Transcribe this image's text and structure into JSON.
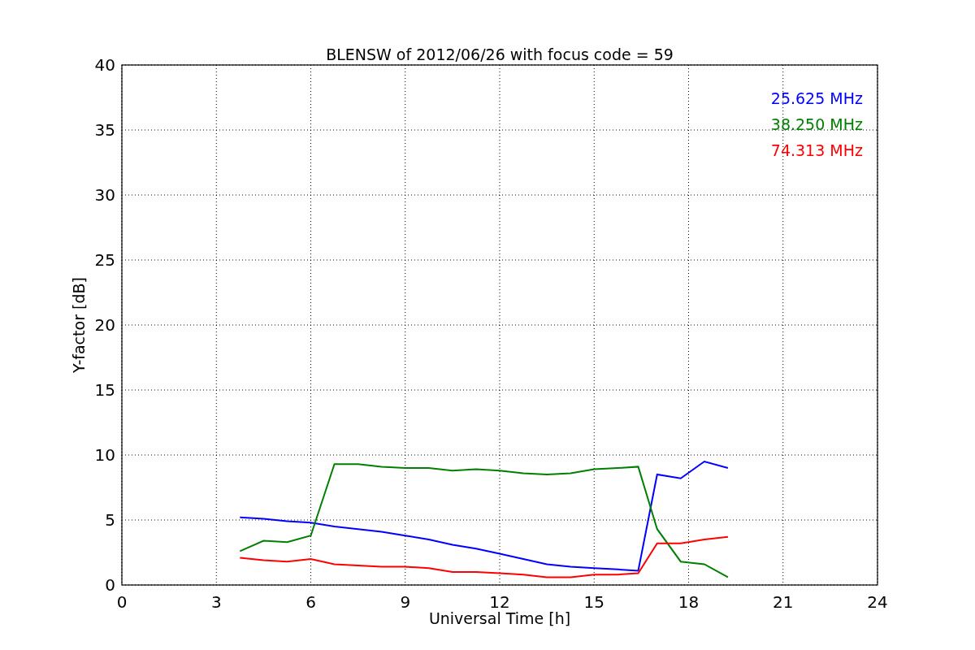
{
  "chart_data": {
    "type": "line",
    "title": "BLENSW of 2012/06/26 with focus code = 59",
    "xlabel": "Universal Time [h]",
    "ylabel": "Y-factor [dB]",
    "x": [
      3.75,
      4.5,
      5.25,
      6,
      6.75,
      7.5,
      8.25,
      9,
      9.75,
      10.5,
      11.25,
      12,
      12.75,
      13.5,
      14.25,
      15,
      15.75,
      16.4,
      17,
      17.75,
      18.5,
      19.25
    ],
    "series": [
      {
        "name": "25.625 MHz",
        "color": "#0000ff",
        "values": [
          5.2,
          5.1,
          4.9,
          4.8,
          4.5,
          4.3,
          4.1,
          3.8,
          3.5,
          3.1,
          2.8,
          2.4,
          2.0,
          1.6,
          1.4,
          1.3,
          1.2,
          1.1,
          8.5,
          8.2,
          9.5,
          9.0
        ]
      },
      {
        "name": "38.250 MHz",
        "color": "#008000",
        "values": [
          2.6,
          3.4,
          3.3,
          3.8,
          9.3,
          9.3,
          9.1,
          9.0,
          9.0,
          8.8,
          8.9,
          8.8,
          8.6,
          8.5,
          8.6,
          8.9,
          9.0,
          9.1,
          4.3,
          1.8,
          1.6,
          0.6
        ]
      },
      {
        "name": "74.313 MHz",
        "color": "#ff0000",
        "values": [
          2.1,
          1.9,
          1.8,
          2.0,
          1.6,
          1.5,
          1.4,
          1.4,
          1.3,
          1.0,
          1.0,
          0.9,
          0.8,
          0.6,
          0.6,
          0.8,
          0.8,
          0.9,
          3.2,
          3.2,
          3.5,
          3.7
        ]
      }
    ],
    "grid": true,
    "xlim": [
      0,
      24
    ],
    "ylim": [
      0,
      40
    ],
    "xticks": [
      0,
      3,
      6,
      9,
      12,
      15,
      18,
      21,
      24
    ],
    "yticks": [
      0,
      5,
      10,
      15,
      20,
      25,
      30,
      35,
      40
    ]
  }
}
